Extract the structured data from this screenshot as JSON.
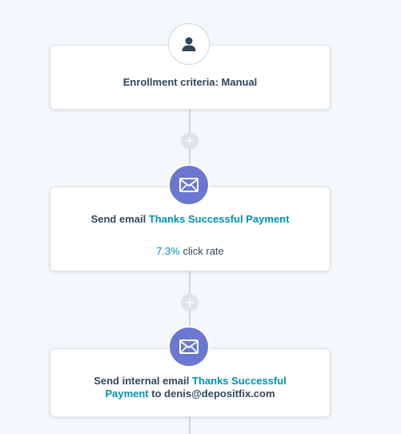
{
  "workflow": {
    "trigger": {
      "icon": "person-icon",
      "label": "Enrollment criteria: Manual"
    },
    "add_action_symbol": "+",
    "actions": [
      {
        "icon": "envelope-icon",
        "prefix": "Send email",
        "link": "Thanks Successful Payment",
        "stat_value": "7.3%",
        "stat_label": "click rate"
      },
      {
        "icon": "envelope-icon",
        "prefix": "Send internal email",
        "link_part1": "Thanks Successful",
        "link_part2": "Payment",
        "middle": "to",
        "recipient": "denis@depositfix.com"
      }
    ]
  },
  "colors": {
    "background": "#f5f8fa",
    "accent_link": "#0091ae",
    "email_action": "#6a78d1",
    "connector": "#cbd6e2",
    "text": "#33475b"
  }
}
